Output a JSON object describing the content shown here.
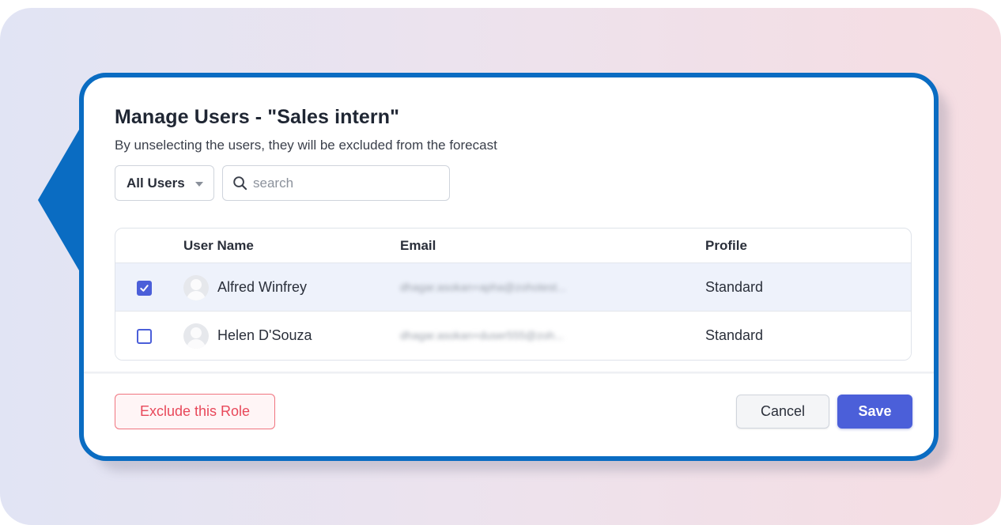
{
  "dialog": {
    "title": "Manage Users - \"Sales intern\"",
    "subtitle": "By unselecting the users, they will be excluded from the forecast"
  },
  "filters": {
    "role_select": {
      "selected": "All Users",
      "icon": "chevron-down-icon"
    },
    "search": {
      "placeholder": "search",
      "value": "",
      "icon": "search-icon"
    }
  },
  "table": {
    "columns": [
      "User Name",
      "Email",
      "Profile"
    ],
    "rows": [
      {
        "checked": true,
        "name": "Alfred Winfrey",
        "email": "dhagar.asokan+apha@zohotest...",
        "profile": "Standard"
      },
      {
        "checked": false,
        "name": "Helen D'Souza",
        "email": "dhagar.asokan+duser555@zoh...",
        "profile": "Standard"
      }
    ]
  },
  "footer": {
    "exclude_label": "Exclude this Role",
    "cancel_label": "Cancel",
    "save_label": "Save"
  },
  "colors": {
    "frame_border": "#0a6cc2",
    "primary": "#4b5fd9",
    "danger": "#e8485a",
    "selected_row": "#eef2fb"
  }
}
